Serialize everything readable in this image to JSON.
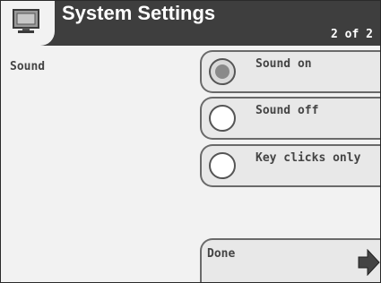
{
  "header": {
    "title": "System Settings",
    "page_indicator": "2 of 2",
    "icon": "monitor-icon"
  },
  "section": {
    "label": "Sound"
  },
  "options": [
    {
      "label": "Sound on",
      "selected": true
    },
    {
      "label": "Sound off",
      "selected": false
    },
    {
      "label": "Key clicks only",
      "selected": false
    }
  ],
  "done_button": {
    "label": "Done",
    "icon": "arrow-right-icon"
  },
  "colors": {
    "header_bg": "#3e3e3e",
    "panel_bg": "#f2f2f2",
    "button_bg": "#e8e8e8"
  }
}
